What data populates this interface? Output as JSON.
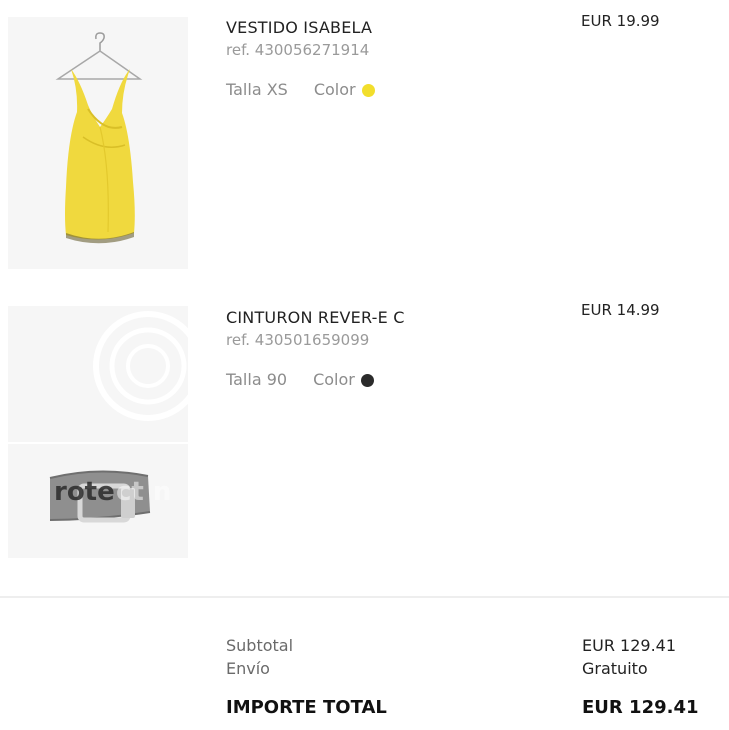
{
  "items": [
    {
      "name": "VESTIDO ISABELA",
      "ref": "ref. 430056271914",
      "size": "Talla XS",
      "color_label": "Color",
      "color_hex": "#f2de2c",
      "price": "EUR 19.99",
      "image_icon": "yellow-dress-icon"
    },
    {
      "name": "CINTURON REVER-E C",
      "ref": "ref. 430501659099",
      "size": "Talla 90",
      "color_label": "Color",
      "color_hex": "#2b2b2b",
      "price": "EUR 14.99",
      "image_icon": "grey-belt-icon"
    }
  ],
  "summary": {
    "subtotal_label": "Subtotal",
    "subtotal_value": "EUR 129.41",
    "shipping_label": "Envío",
    "shipping_value": "Gratuito",
    "total_label": "IMPORTE TOTAL",
    "total_value": "EUR 129.41"
  }
}
